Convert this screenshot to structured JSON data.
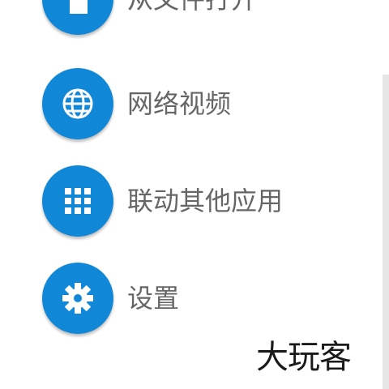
{
  "menu": {
    "items": [
      {
        "label": "从文件打开",
        "icon": "file-icon"
      },
      {
        "label": "网络视频",
        "icon": "globe-icon"
      },
      {
        "label": "联动其他应用",
        "icon": "grid-icon"
      },
      {
        "label": "设置",
        "icon": "gear-icon"
      }
    ]
  },
  "watermark": {
    "text": "大玩客"
  },
  "colors": {
    "accent": "#1187d8",
    "label": "#666666",
    "background": "#ffffff"
  }
}
